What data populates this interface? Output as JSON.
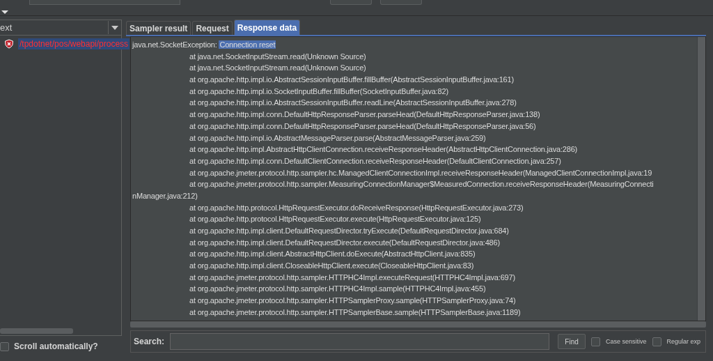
{
  "left_panel": {
    "column_header": "ext",
    "results": [
      {
        "label": "/tpdotnet/pos/webapi/process",
        "kind": "error",
        "selected": true
      }
    ],
    "scroll_automatically": {
      "label": "Scroll automatically?",
      "checked": false
    }
  },
  "tabs": [
    {
      "label": "Sampler result",
      "selected": false
    },
    {
      "label": "Request",
      "selected": false
    },
    {
      "label": "Response data",
      "selected": true
    }
  ],
  "response_lines": [
    {
      "kind": "exception",
      "text": "java.net.SocketException: ",
      "selection": "Connection reset"
    },
    {
      "kind": "frame",
      "text": "at java.net.SocketInputStream.read(Unknown Source)"
    },
    {
      "kind": "frame",
      "text": "at java.net.SocketInputStream.read(Unknown Source)"
    },
    {
      "kind": "frame",
      "text": "at org.apache.http.impl.io.AbstractSessionInputBuffer.fillBuffer(AbstractSessionInputBuffer.java:161)"
    },
    {
      "kind": "frame",
      "text": "at org.apache.http.impl.io.SocketInputBuffer.fillBuffer(SocketInputBuffer.java:82)"
    },
    {
      "kind": "frame",
      "text": "at org.apache.http.impl.io.AbstractSessionInputBuffer.readLine(AbstractSessionInputBuffer.java:278)"
    },
    {
      "kind": "frame",
      "text": "at org.apache.http.impl.conn.DefaultHttpResponseParser.parseHead(DefaultHttpResponseParser.java:138)"
    },
    {
      "kind": "frame",
      "text": "at org.apache.http.impl.conn.DefaultHttpResponseParser.parseHead(DefaultHttpResponseParser.java:56)"
    },
    {
      "kind": "frame",
      "text": "at org.apache.http.impl.io.AbstractMessageParser.parse(AbstractMessageParser.java:259)"
    },
    {
      "kind": "frame",
      "text": "at org.apache.http.impl.AbstractHttpClientConnection.receiveResponseHeader(AbstractHttpClientConnection.java:286)"
    },
    {
      "kind": "frame",
      "text": "at org.apache.http.impl.conn.DefaultClientConnection.receiveResponseHeader(DefaultClientConnection.java:257)"
    },
    {
      "kind": "frame",
      "text": "at org.apache.jmeter.protocol.http.sampler.hc.ManagedClientConnectionImpl.receiveResponseHeader(ManagedClientConnectionImpl.java:19"
    },
    {
      "kind": "frame",
      "text": "at org.apache.jmeter.protocol.http.sampler.MeasuringConnectionManager$MeasuredConnection.receiveResponseHeader(MeasuringConnecti"
    },
    {
      "kind": "wrap",
      "text": "nManager.java:212)"
    },
    {
      "kind": "frame",
      "text": "at org.apache.http.protocol.HttpRequestExecutor.doReceiveResponse(HttpRequestExecutor.java:273)"
    },
    {
      "kind": "frame",
      "text": "at org.apache.http.protocol.HttpRequestExecutor.execute(HttpRequestExecutor.java:125)"
    },
    {
      "kind": "frame",
      "text": "at org.apache.http.impl.client.DefaultRequestDirector.tryExecute(DefaultRequestDirector.java:684)"
    },
    {
      "kind": "frame",
      "text": "at org.apache.http.impl.client.DefaultRequestDirector.execute(DefaultRequestDirector.java:486)"
    },
    {
      "kind": "frame",
      "text": "at org.apache.http.impl.client.AbstractHttpClient.doExecute(AbstractHttpClient.java:835)"
    },
    {
      "kind": "frame",
      "text": "at org.apache.http.impl.client.CloseableHttpClient.execute(CloseableHttpClient.java:83)"
    },
    {
      "kind": "frame",
      "text": "at org.apache.jmeter.protocol.http.sampler.HTTPHC4Impl.executeRequest(HTTPHC4Impl.java:697)"
    },
    {
      "kind": "frame",
      "text": "at org.apache.jmeter.protocol.http.sampler.HTTPHC4Impl.sample(HTTPHC4Impl.java:455)"
    },
    {
      "kind": "frame",
      "text": "at org.apache.jmeter.protocol.http.sampler.HTTPSamplerProxy.sample(HTTPSamplerProxy.java:74)"
    },
    {
      "kind": "frame",
      "text": "at org.apache.jmeter.protocol.http.sampler.HTTPSamplerBase.sample(HTTPSamplerBase.java:1189)"
    }
  ],
  "search": {
    "label": "Search:",
    "find_button": "Find",
    "case_sensitive": {
      "label": "Case sensitive",
      "checked": false
    },
    "regular_exp": {
      "label": "Regular exp",
      "checked": false
    }
  }
}
